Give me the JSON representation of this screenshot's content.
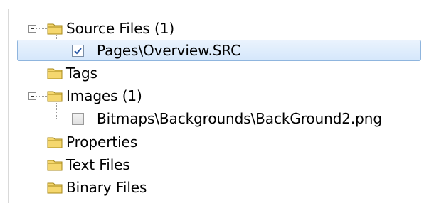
{
  "tree": {
    "source_files": {
      "label": "Source Files (1)",
      "expanded": true
    },
    "source_child": {
      "label": "Pages\\Overview.SRC",
      "checked": true,
      "selected": true
    },
    "tags": {
      "label": "Tags"
    },
    "images": {
      "label": "Images (1)",
      "expanded": true
    },
    "images_child": {
      "label": "Bitmaps\\Backgrounds\\BackGround2.png",
      "checked": false
    },
    "properties": {
      "label": "Properties"
    },
    "text_files": {
      "label": "Text Files"
    },
    "binary_files": {
      "label": "Binary Files"
    }
  },
  "icons": {
    "folder": "folder-icon",
    "expander": "collapse-minus-icon",
    "check": "checkmark-icon"
  },
  "colors": {
    "selection_fill": "#d5e7fb",
    "selection_border": "#8fb5de",
    "folder_fill": "#f5d76e",
    "folder_stroke": "#a88a1a",
    "check_mark": "#2a5aa8"
  }
}
